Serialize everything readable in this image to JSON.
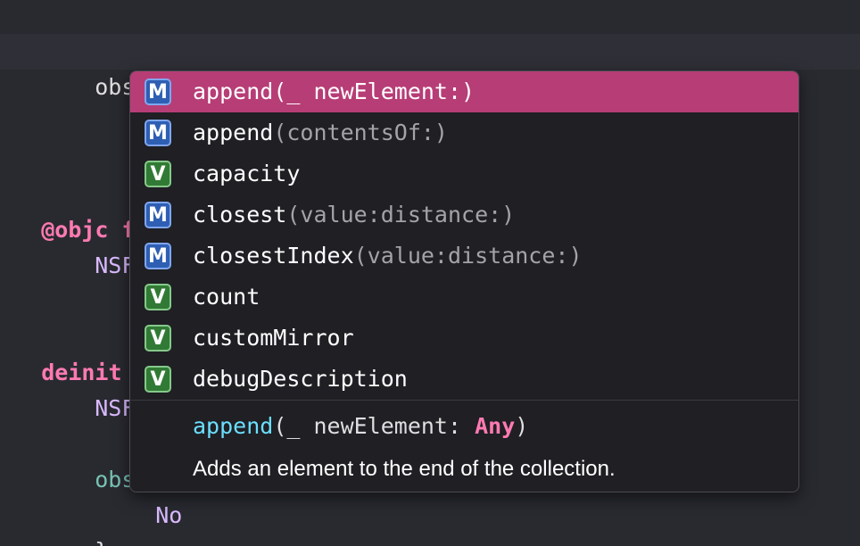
{
  "code": {
    "line_observers_dot": "observers.",
    "objc_kw": "@objc func",
    "nsfile1": "NSFile",
    "deinit_kw": "deinit",
    "deinit_brace": " {",
    "nsfile2": "NSFile",
    "observ": "observ",
    "no": "No",
    "close_brace": "}"
  },
  "completion": {
    "items": [
      {
        "kind": "M",
        "name": "append",
        "args": "(_ newElement:)",
        "selected": true
      },
      {
        "kind": "M",
        "name": "append",
        "args": "(contentsOf:)"
      },
      {
        "kind": "V",
        "name": "capacity",
        "args": ""
      },
      {
        "kind": "M",
        "name": "closest",
        "args": "(value:distance:)"
      },
      {
        "kind": "M",
        "name": "closestIndex",
        "args": "(value:distance:)"
      },
      {
        "kind": "V",
        "name": "count",
        "args": ""
      },
      {
        "kind": "V",
        "name": "customMirror",
        "args": ""
      },
      {
        "kind": "V",
        "name": "debugDescription",
        "args": ""
      }
    ],
    "signature": {
      "fn": "append",
      "open": "(_ newElement: ",
      "type": "Any",
      "close": ")"
    },
    "description": "Adds an element to the end of the collection."
  },
  "colors": {
    "selection": "#b73d76",
    "method_badge": "#2e5fb3",
    "var_badge": "#317a35",
    "keyword": "#ff7ab2"
  }
}
